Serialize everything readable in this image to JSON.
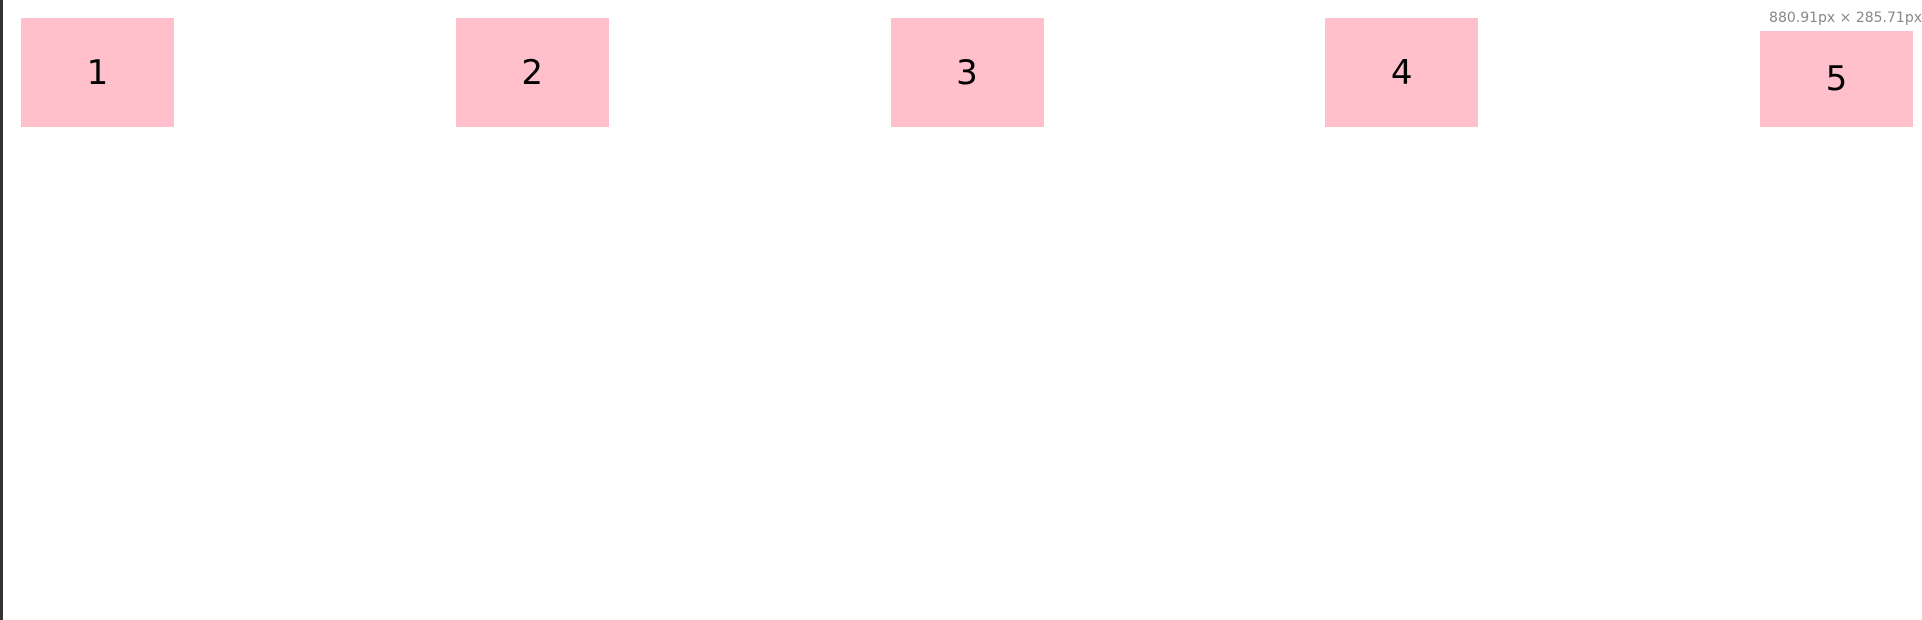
{
  "colors": {
    "box_bg": "#ffc0cb",
    "text": "#000000",
    "readout": "#888888",
    "frame": "#333333"
  },
  "boxes": [
    {
      "label": "1"
    },
    {
      "label": "2"
    },
    {
      "label": "3"
    },
    {
      "label": "4"
    },
    {
      "label": "5"
    }
  ],
  "inspector": {
    "dimensions_label": "880.91px × 285.71px"
  }
}
